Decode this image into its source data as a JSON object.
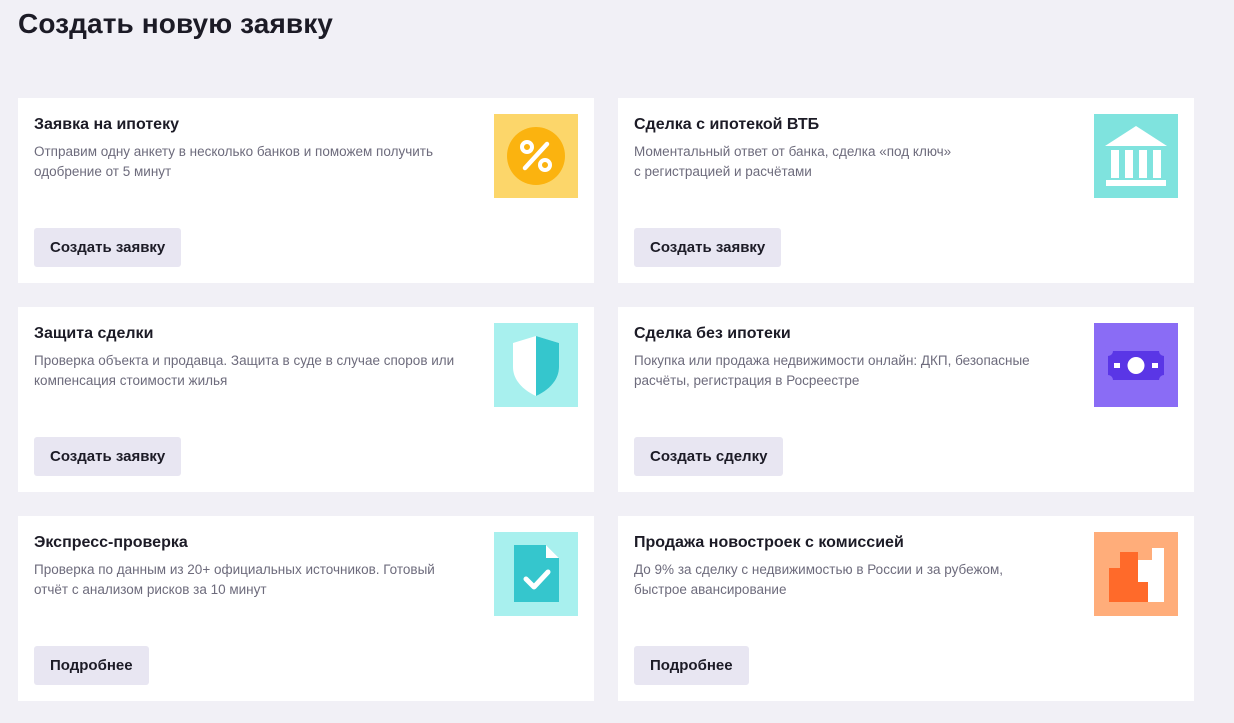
{
  "page": {
    "title": "Создать новую заявку"
  },
  "cards": [
    {
      "title": "Заявка на ипотеку",
      "description": "Отправим одну анкету в несколько банков и поможем получить\nодобрение от 5 минут",
      "button_label": "Создать заявку",
      "icon": "percent-icon",
      "icon_bg": "#fcd66a",
      "icon_fg": "#fbb30f"
    },
    {
      "title": "Сделка с ипотекой ВТБ",
      "description": "Моментальный ответ от банка, сделка «под ключ»\nс регистрацией и расчётами",
      "button_label": "Создать заявку",
      "icon": "bank-icon",
      "icon_bg": "#7fe3de",
      "icon_fg": "#ffffff"
    },
    {
      "title": "Защита сделки",
      "description": "Проверка объекта и продавца. Защита в суде в случае споров или\nкомпенсация стоимости жилья",
      "button_label": "Создать заявку",
      "icon": "shield-icon",
      "icon_bg": "#a8f0ee",
      "icon_fg": "#35c6cd"
    },
    {
      "title": "Сделка без ипотеки",
      "description": "Покупка или продажа недвижимости онлайн: ДКП, безопасные\nрасчёты, регистрация в Росреестре",
      "button_label": "Создать сделку",
      "icon": "banknote-icon",
      "icon_bg": "#8a6cf5",
      "icon_fg": "#5a36e6"
    },
    {
      "title": "Экспресс-проверка",
      "description": "Проверка по данным из 20+ официальных источников. Готовый\nотчёт с анализом рисков за 10 минут",
      "button_label": "Подробнее",
      "icon": "document-check-icon",
      "icon_bg": "#a8f0ee",
      "icon_fg": "#35c6cd"
    },
    {
      "title": "Продажа новостроек с комиссией",
      "description": "До 9% за сделку с недвижимостью в России и за рубежом,\nбыстрое авансирование",
      "button_label": "Подробнее",
      "icon": "buildings-icon",
      "icon_bg": "#ffad7a",
      "icon_fg": "#ff6a2a"
    }
  ]
}
